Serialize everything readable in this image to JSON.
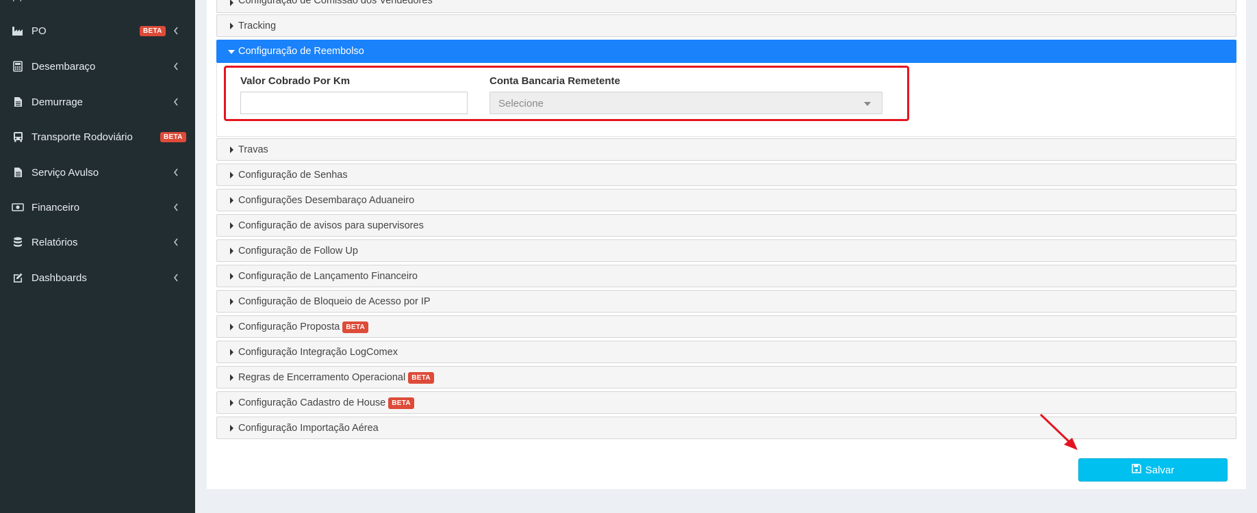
{
  "sidebar": {
    "partial_top": "( ) ",
    "items": [
      {
        "label": "PO",
        "icon": "factory-icon",
        "badge": "BETA",
        "chevron": true
      },
      {
        "label": "Desembaraço",
        "icon": "calculator-icon",
        "badge": "",
        "chevron": true
      },
      {
        "label": "Demurrage",
        "icon": "document-icon",
        "badge": "",
        "chevron": true
      },
      {
        "label": "Transporte Rodoviário",
        "icon": "bus-icon",
        "badge": "BETA",
        "chevron": false
      },
      {
        "label": "Serviço Avulso",
        "icon": "document-icon",
        "badge": "",
        "chevron": true
      },
      {
        "label": "Financeiro",
        "icon": "money-icon",
        "badge": "",
        "chevron": true
      },
      {
        "label": "Relatórios",
        "icon": "database-icon",
        "badge": "",
        "chevron": true
      },
      {
        "label": "Dashboards",
        "icon": "edit-icon",
        "badge": "",
        "chevron": true
      }
    ]
  },
  "accordion": {
    "partial_top": "Configuração de Comissão dos Vendedores",
    "tracking": "Tracking",
    "active": "Configuração de Reembolso",
    "sections": [
      {
        "label": "Travas",
        "badge": ""
      },
      {
        "label": "Configuração de Senhas",
        "badge": ""
      },
      {
        "label": "Configurações Desembaraço Aduaneiro",
        "badge": ""
      },
      {
        "label": "Configuração de avisos para supervisores",
        "badge": ""
      },
      {
        "label": "Configuração de Follow Up",
        "badge": ""
      },
      {
        "label": "Configuração de Lançamento Financeiro",
        "badge": ""
      },
      {
        "label": "Configuração de Bloqueio de Acesso por IP",
        "badge": ""
      },
      {
        "label": "Configuração Proposta",
        "badge": "BETA"
      },
      {
        "label": "Configuração Integração LogComex",
        "badge": ""
      },
      {
        "label": "Regras de Encerramento Operacional",
        "badge": "BETA"
      },
      {
        "label": "Configuração Cadastro de House",
        "badge": "BETA"
      },
      {
        "label": "Configuração Importação Aérea",
        "badge": ""
      }
    ]
  },
  "form": {
    "valor_label": "Valor Cobrado Por Km",
    "valor_value": "",
    "conta_label": "Conta Bancaria Remetente",
    "conta_placeholder": "Selecione"
  },
  "actions": {
    "save_label": "Salvar"
  },
  "colors": {
    "sidebar_bg": "#222d32",
    "active_accordion": "#1a82fb",
    "badge": "#dd4b39",
    "save_button": "#00c0ef",
    "annotation_red": "#e4141f"
  }
}
